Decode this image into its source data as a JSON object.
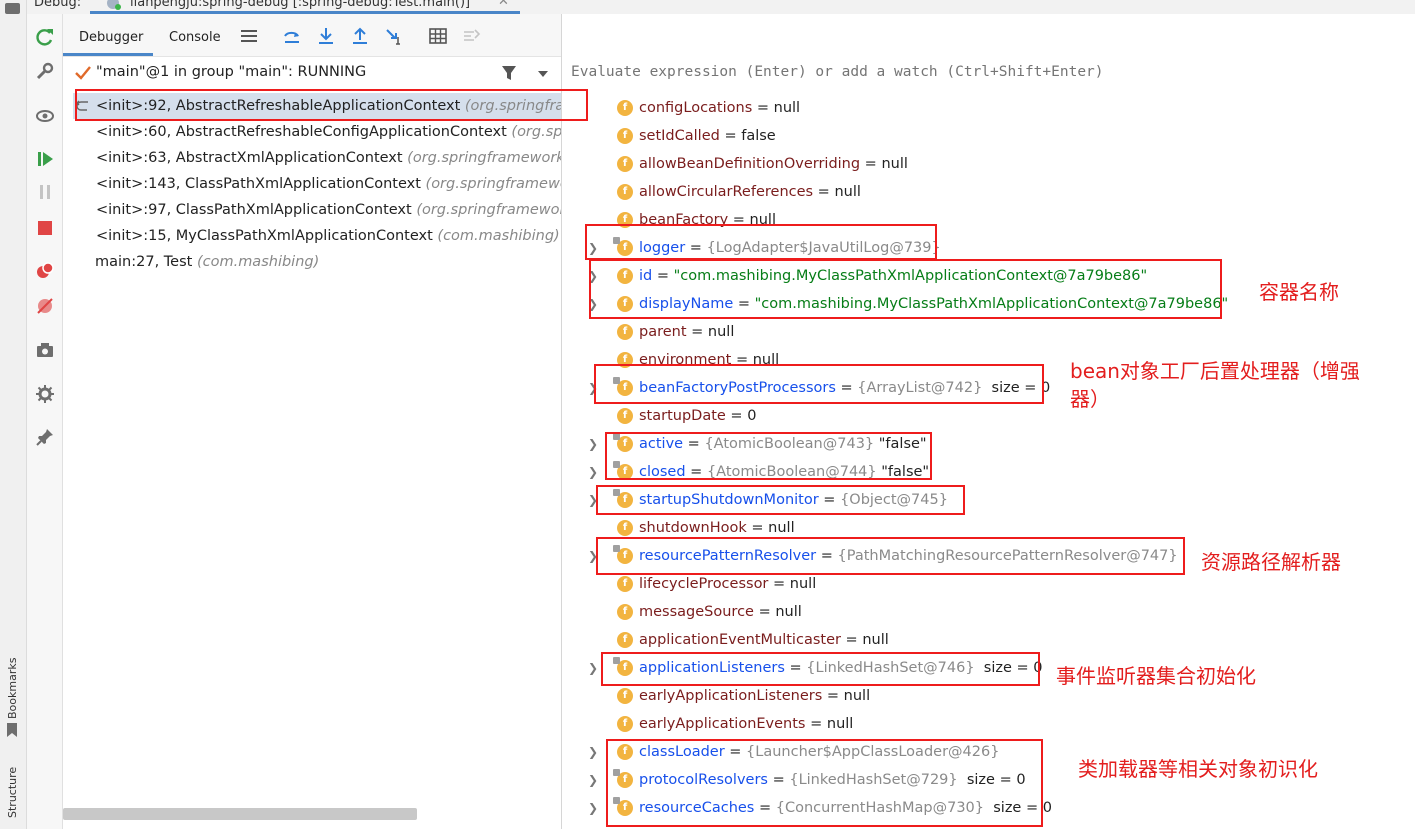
{
  "topbar": {
    "debug_label": "Debug:",
    "session_title": "lianpengju:spring-debug [:spring-debug:Test.main()]",
    "close_icon": "close-icon"
  },
  "side_tabs": {
    "bookmarks": "Bookmarks",
    "structure": "Structure"
  },
  "debug_tabs": [
    {
      "label": "Debugger"
    },
    {
      "label": "Console"
    }
  ],
  "thread": {
    "label": "\"main\"@1 in group \"main\": RUNNING"
  },
  "frames": [
    {
      "method": "<init>:92, AbstractRefreshableApplicationContext ",
      "pkg": "(org.springframework.context.support)"
    },
    {
      "method": "<init>:60, AbstractRefreshableConfigApplicationContext ",
      "pkg": "(org.springframework.context.support)"
    },
    {
      "method": "<init>:63, AbstractXmlApplicationContext ",
      "pkg": "(org.springframework.context.support)"
    },
    {
      "method": "<init>:143, ClassPathXmlApplicationContext ",
      "pkg": "(org.springframework.context.support)"
    },
    {
      "method": "<init>:97, ClassPathXmlApplicationContext ",
      "pkg": "(org.springframework.context.support)"
    },
    {
      "method": "<init>:15, MyClassPathXmlApplicationContext ",
      "pkg": "(com.mashibing)"
    },
    {
      "method": "main:27, Test ",
      "pkg": "(com.mashibing)"
    }
  ],
  "evaluate": {
    "placeholder": "Evaluate expression (Enter) or add a watch (Ctrl+Shift+Enter)"
  },
  "variables": [
    {
      "name": "configLocations",
      "eq": " = ",
      "value": "null",
      "vtype": "plain"
    },
    {
      "name": "setIdCalled",
      "eq": " = ",
      "value": "false",
      "vtype": "plain"
    },
    {
      "name": "allowBeanDefinitionOverriding",
      "eq": " = ",
      "value": "null",
      "vtype": "plain"
    },
    {
      "name": "allowCircularReferences",
      "eq": " = ",
      "value": "null",
      "vtype": "plain"
    },
    {
      "name": "beanFactory",
      "eq": " = ",
      "value": "null",
      "vtype": "plain"
    },
    {
      "name": "logger",
      "eq": " = ",
      "value": "{LogAdapter$JavaUtilLog@739}",
      "vtype": "ref"
    },
    {
      "name": "id",
      "eq": " = ",
      "value": "\"com.mashibing.MyClassPathXmlApplicationContext@7a79be86\"",
      "vtype": "str"
    },
    {
      "name": "displayName",
      "eq": " = ",
      "value": "\"com.mashibing.MyClassPathXmlApplicationContext@7a79be86\"",
      "vtype": "str"
    },
    {
      "name": "parent",
      "eq": " = ",
      "value": "null",
      "vtype": "plain"
    },
    {
      "name": "environment",
      "eq": " = ",
      "value": "null",
      "vtype": "plain"
    },
    {
      "name": "beanFactoryPostProcessors",
      "eq": " = ",
      "value": "{ArrayList@742}",
      "extra": "  size = 0",
      "vtype": "ref"
    },
    {
      "name": "startupDate",
      "eq": " = ",
      "value": "0",
      "vtype": "plain"
    },
    {
      "name": "active",
      "eq": " = ",
      "value": "{AtomicBoolean@743}",
      "extra": " \"false\"",
      "vtype": "ref"
    },
    {
      "name": "closed",
      "eq": " = ",
      "value": "{AtomicBoolean@744}",
      "extra": " \"false\"",
      "vtype": "ref"
    },
    {
      "name": "startupShutdownMonitor",
      "eq": " = ",
      "value": "{Object@745}",
      "vtype": "ref"
    },
    {
      "name": "shutdownHook",
      "eq": " = ",
      "value": "null",
      "vtype": "plain"
    },
    {
      "name": "resourcePatternResolver",
      "eq": " = ",
      "value": "{PathMatchingResourcePatternResolver@747}",
      "vtype": "ref"
    },
    {
      "name": "lifecycleProcessor",
      "eq": " = ",
      "value": "null",
      "vtype": "plain"
    },
    {
      "name": "messageSource",
      "eq": " = ",
      "value": "null",
      "vtype": "plain"
    },
    {
      "name": "applicationEventMulticaster",
      "eq": " = ",
      "value": "null",
      "vtype": "plain"
    },
    {
      "name": "applicationListeners",
      "eq": " = ",
      "value": "{LinkedHashSet@746}",
      "extra": "  size = 0",
      "vtype": "ref"
    },
    {
      "name": "earlyApplicationListeners",
      "eq": " = ",
      "value": "null",
      "vtype": "plain"
    },
    {
      "name": "earlyApplicationEvents",
      "eq": " = ",
      "value": "null",
      "vtype": "plain"
    },
    {
      "name": "classLoader",
      "eq": " = ",
      "value": "{Launcher$AppClassLoader@426}",
      "vtype": "ref"
    },
    {
      "name": "protocolResolvers",
      "eq": " = ",
      "value": "{LinkedHashSet@729}",
      "extra": "  size = 0",
      "vtype": "ref"
    },
    {
      "name": "resourceCaches",
      "eq": " = ",
      "value": "{ConcurrentHashMap@730}",
      "extra": "  size = 0",
      "vtype": "ref"
    }
  ],
  "annotations": {
    "container_name": "容器名称",
    "bfpp_line1": "bean对象工厂后置处理器（增强",
    "bfpp_line2": "器）",
    "resource_resolver": "资源路径解析器",
    "listeners": "事件监听器集合初始化",
    "classloader": "类加载器等相关对象初识化"
  },
  "colors": {
    "annotation_red": "#e31e1e",
    "selection": "#d5dfec",
    "accent": "#4a86c8"
  },
  "badge_letter": "f"
}
